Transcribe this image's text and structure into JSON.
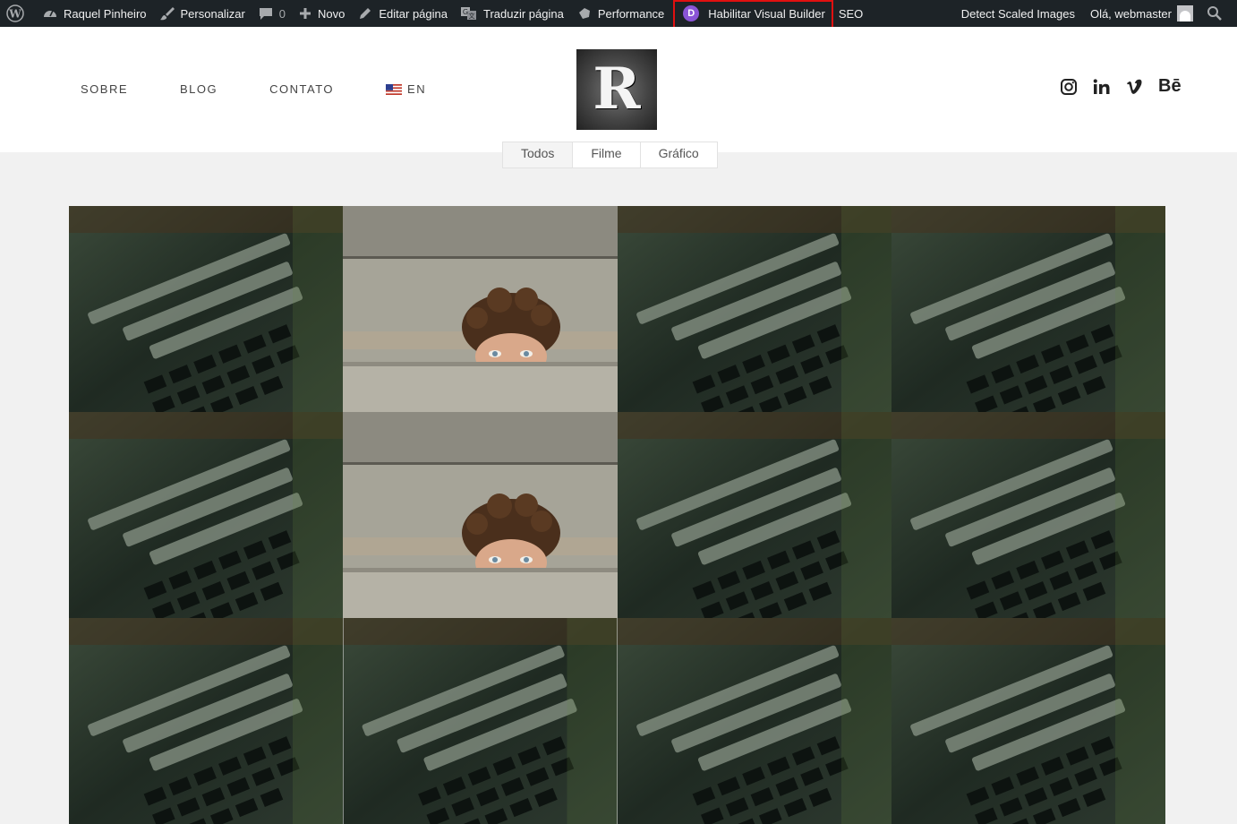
{
  "adminbar": {
    "site_name": "Raquel Pinheiro",
    "customize": "Personalizar",
    "comments_count": "0",
    "new": "Novo",
    "edit_page": "Editar página",
    "translate_page": "Traduzir página",
    "performance": "Performance",
    "visual_builder": "Habilitar Visual Builder",
    "divi_letter": "D",
    "seo": "SEO",
    "detect_scaled": "Detect Scaled Images",
    "greeting": "Olá, webmaster"
  },
  "header": {
    "nav": [
      {
        "label": "SOBRE"
      },
      {
        "label": "BLOG"
      },
      {
        "label": "CONTATO"
      },
      {
        "label": "EN"
      }
    ],
    "logo_letter": "R",
    "social": {
      "behance": "Bē"
    }
  },
  "filters": {
    "tabs": [
      {
        "label": "Todos"
      },
      {
        "label": "Filme"
      },
      {
        "label": "Gráfico"
      }
    ]
  },
  "portfolio": {
    "tiles": [
      {
        "kind": "type"
      },
      {
        "kind": "face"
      },
      {
        "kind": "type"
      },
      {
        "kind": "type"
      },
      {
        "kind": "type"
      },
      {
        "kind": "face"
      },
      {
        "kind": "type"
      },
      {
        "kind": "type"
      },
      {
        "kind": "type"
      },
      {
        "kind": "type"
      },
      {
        "kind": "type"
      },
      {
        "kind": "type"
      }
    ]
  },
  "colors": {
    "adminbar_bg": "#1d2327",
    "highlight": "#e01010",
    "divi_purple": "#8a54d6"
  }
}
